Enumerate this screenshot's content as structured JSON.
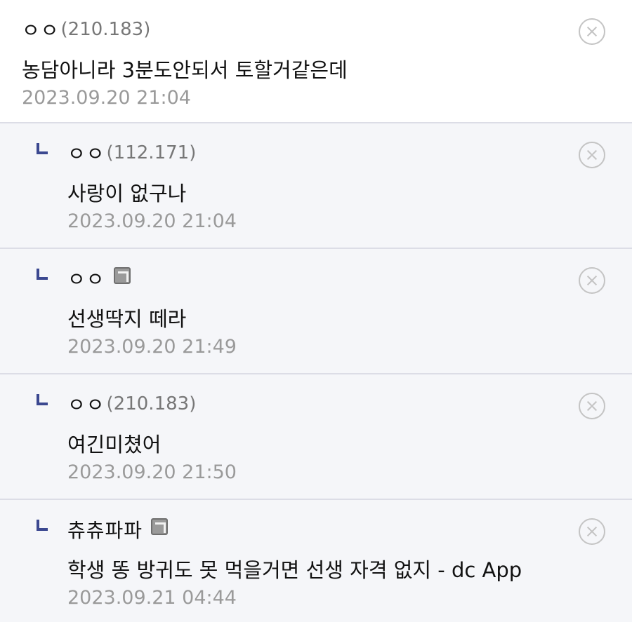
{
  "comments": [
    {
      "nick": "ㅇㅇ",
      "ip": "(210.183)",
      "text": "농담아니라 3분도안되서 토할거같은데",
      "date": "2023.09.20 21:04"
    },
    {
      "nick": "ㅇㅇ",
      "ip": "(112.171)",
      "text": "사랑이 없구나",
      "date": "2023.09.20 21:04"
    },
    {
      "nick": "ㅇㅇ",
      "ip": "",
      "text": "선생딱지 떼라",
      "date": "2023.09.20 21:49"
    },
    {
      "nick": "ㅇㅇ",
      "ip": "(210.183)",
      "text": "여긴미쳤어",
      "date": "2023.09.20 21:50"
    },
    {
      "nick": "츄츄파파",
      "ip": "",
      "text": "학생 똥 방귀도 못 먹을거면 선생 자격 없지 - dc App",
      "date": "2023.09.21 04:44"
    }
  ],
  "icons": {
    "delete": "close-circle-icon",
    "reply": "reply-arrow-icon",
    "fixed_nick": "fixed-nick-icon"
  },
  "colors": {
    "reply_mark": "#3b4890",
    "reply_bg": "#f5f6f9",
    "divider": "#dcdde6",
    "date": "#9a9a9a"
  }
}
